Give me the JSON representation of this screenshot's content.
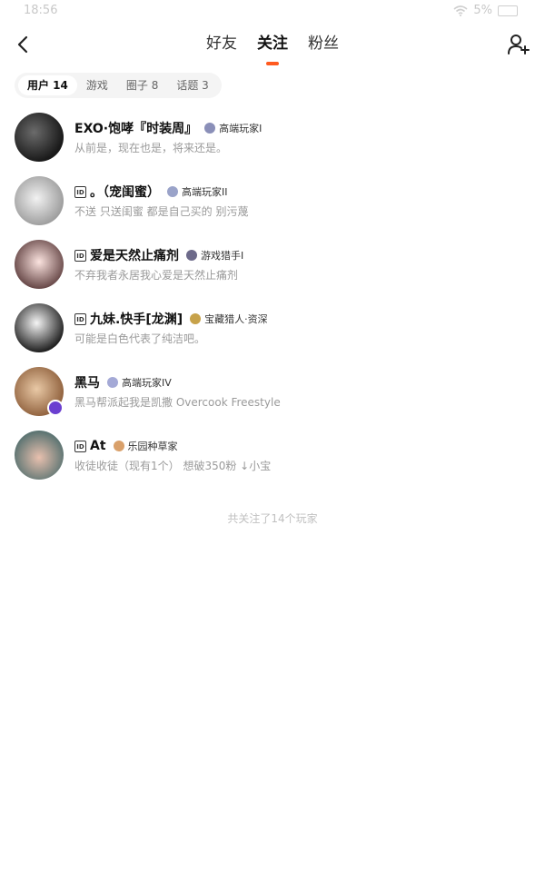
{
  "status_bar": {
    "time": "18:56",
    "battery": "5%"
  },
  "nav": {
    "tabs": [
      {
        "label": "好友",
        "active": false
      },
      {
        "label": "关注",
        "active": true
      },
      {
        "label": "粉丝",
        "active": false
      }
    ],
    "accent_color": "#ff5a1f"
  },
  "filters": [
    {
      "label": "用户 14",
      "active": true
    },
    {
      "label": "游戏",
      "active": false
    },
    {
      "label": "圈子 8",
      "active": false
    },
    {
      "label": "话题 3",
      "active": false
    }
  ],
  "users": [
    {
      "name": "EXO·饱哮『时装周』",
      "level": "高端玩家I",
      "bio": "从前是，现在也是，将来还是。"
    },
    {
      "name": "。（宠闺蜜）",
      "level": "高端玩家II",
      "bio": "不送 只送闺蜜 都是自己买的 别污蔑"
    },
    {
      "name": "爱是天然止痛剂",
      "level": "游戏猎手I",
      "bio": "不弃我者永居我心爱是天然止痛剂"
    },
    {
      "name": "九妹.快手[龙渊]",
      "level": "宝藏猎人·资深",
      "bio": "可能是白色代表了纯洁吧。"
    },
    {
      "name": "黑马",
      "level": "高端玩家IV",
      "bio": "黑马帮派起我是凯撒 Overcook Freestyle"
    },
    {
      "name": "At",
      "level": "乐园种草家",
      "bio": "收徒收徒（现有1个） 想破350粉 ↓小宝"
    }
  ],
  "footer": "共关注了14个玩家"
}
